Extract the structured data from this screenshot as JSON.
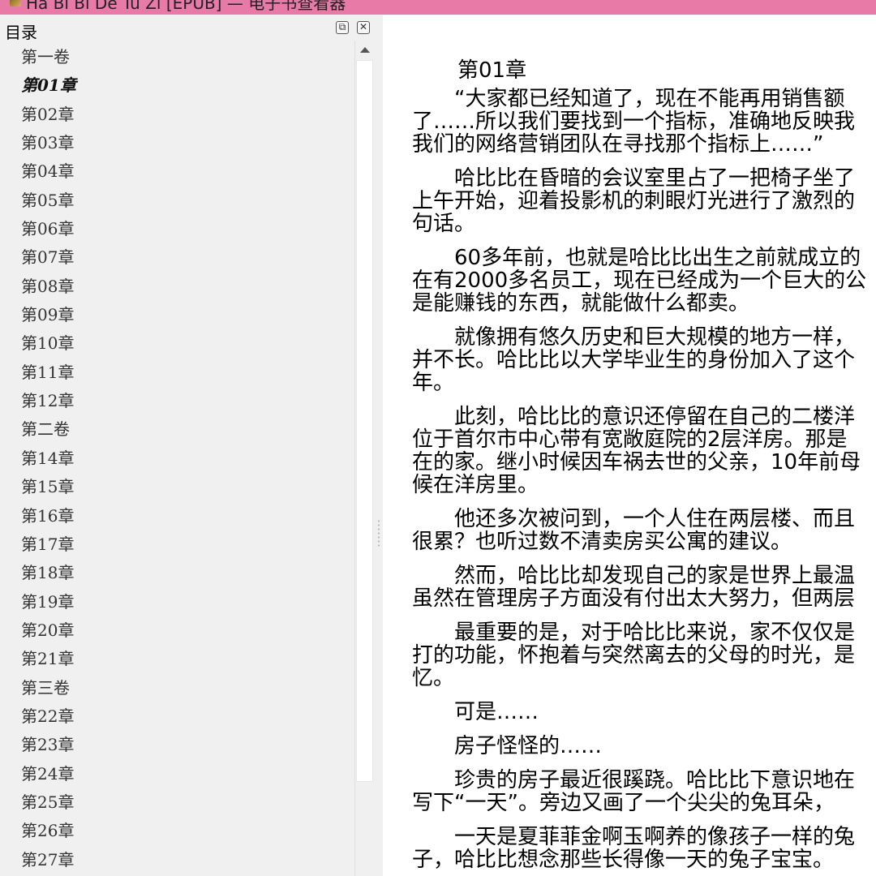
{
  "window": {
    "title": "Ha Bi Bi De Tu Zi [EPUB] — 电子书查看器"
  },
  "sidebar": {
    "title": "目录",
    "restore_label": "⧉",
    "close_label": "✕",
    "items": [
      {
        "label": "第一卷"
      },
      {
        "label": "第01章",
        "current": true
      },
      {
        "label": "第02章"
      },
      {
        "label": "第03章"
      },
      {
        "label": "第04章"
      },
      {
        "label": "第05章"
      },
      {
        "label": "第06章"
      },
      {
        "label": "第07章"
      },
      {
        "label": "第08章"
      },
      {
        "label": "第09章"
      },
      {
        "label": "第10章"
      },
      {
        "label": "第11章"
      },
      {
        "label": "第12章"
      },
      {
        "label": "第二卷"
      },
      {
        "label": "第14章"
      },
      {
        "label": "第15章"
      },
      {
        "label": "第16章"
      },
      {
        "label": "第17章"
      },
      {
        "label": "第18章"
      },
      {
        "label": "第19章"
      },
      {
        "label": "第20章"
      },
      {
        "label": "第21章"
      },
      {
        "label": "第三卷"
      },
      {
        "label": "第22章"
      },
      {
        "label": "第23章"
      },
      {
        "label": "第24章"
      },
      {
        "label": "第25章"
      },
      {
        "label": "第26章"
      },
      {
        "label": "第27章"
      }
    ]
  },
  "content": {
    "chapter_title": "第01章",
    "paragraphs": [
      [
        "“大家都已经知道了，现在不能再用销售额",
        "了……所以我们要找到一个指标，准确地反映我",
        "我们的网络营销团队在寻找那个指标上……”"
      ],
      [
        "哈比比在昏暗的会议室里占了一把椅子坐了",
        "上午开始，迎着投影机的刺眼灯光进行了激烈的",
        "句话。"
      ],
      [
        "60多年前，也就是哈比比出生之前就成立的",
        "在有2000多名员工，现在已经成为一个巨大的公",
        "是能赚钱的东西，就能做什么都卖。"
      ],
      [
        "就像拥有悠久历史和巨大规模的地方一样，",
        "并不长。哈比比以大学毕业生的身份加入了这个",
        "年。"
      ],
      [
        "此刻，哈比比的意识还停留在自己的二楼洋",
        "位于首尔市中心带有宽敞庭院的2层洋房。那是",
        "在的家。继小时候因车祸去世的父亲，10年前母",
        "候在洋房里。"
      ],
      [
        "他还多次被问到，一个人住在两层楼、而且",
        "很累？也听过数不清卖房买公寓的建议。"
      ],
      [
        "然而，哈比比却发现自己的家是世界上最温",
        "虽然在管理房子方面没有付出太大努力，但两层"
      ],
      [
        "最重要的是，对于哈比比来说，家不仅仅是",
        "打的功能，怀抱着与突然离去的父母的时光，是",
        "忆。"
      ],
      [
        "可是……"
      ],
      [
        "房子怪怪的……"
      ],
      [
        "珍贵的房子最近很蹊跷。哈比比下意识地在",
        "写下“一天”。旁边又画了一个尖尖的兔耳朵，"
      ],
      [
        "一天是夏菲菲金啊玉啊养的像孩子一样的兔",
        "子，哈比比想念那些长得像一天的兔子宝宝。"
      ]
    ]
  }
}
